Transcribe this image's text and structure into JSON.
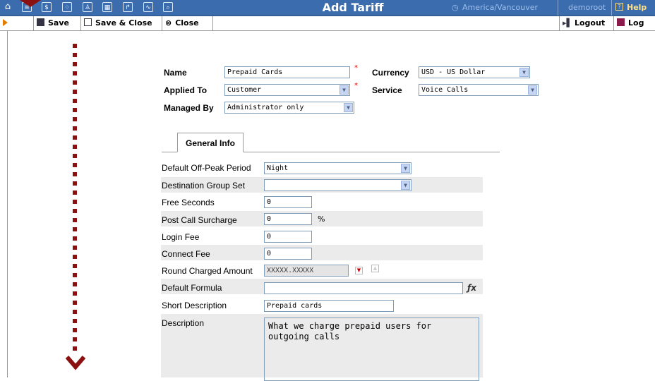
{
  "header": {
    "title": "Add Tariff",
    "timezone": "America/Vancouver",
    "user": "demoroot",
    "help": "Help",
    "nav_icons": [
      "home-icon",
      "list-icon",
      "dollar-icon",
      "network-icon",
      "person-icon",
      "grid-icon",
      "import-icon",
      "chart-icon",
      "search-icon"
    ]
  },
  "toolbar": {
    "save": "Save",
    "save_close": "Save & Close",
    "close": "Close",
    "logout": "Logout",
    "log": "Log"
  },
  "form": {
    "name_label": "Name",
    "name_value": "Prepaid Cards",
    "applied_to_label": "Applied To",
    "applied_to_value": "Customer",
    "managed_by_label": "Managed By",
    "managed_by_value": "Administrator only",
    "currency_label": "Currency",
    "currency_value": "USD - US Dollar",
    "service_label": "Service",
    "service_value": "Voice Calls",
    "required_mark": "*"
  },
  "tabs": {
    "general": "General Info"
  },
  "general": {
    "offpeak_label": "Default Off-Peak Period",
    "offpeak_value": "Night",
    "destgroup_label": "Destination Group Set",
    "destgroup_value": "",
    "freesec_label": "Free Seconds",
    "freesec_value": "0",
    "surcharge_label": "Post Call Surcharge",
    "surcharge_value": "0",
    "surcharge_unit": "%",
    "loginfee_label": "Login Fee",
    "loginfee_value": "0",
    "connectfee_label": "Connect Fee",
    "connectfee_value": "0",
    "round_label": "Round Charged Amount",
    "round_value": "XXXXX.XXXXX",
    "formula_label": "Default Formula",
    "formula_value": "",
    "shortdesc_label": "Short Description",
    "shortdesc_value": "Prepaid cards",
    "desc_label": "Description",
    "desc_value": "What we charge prepaid users for\noutgoing calls"
  },
  "colors": {
    "header": "#3b6cae",
    "annotation": "#8b1010",
    "accent": "#e07d00"
  }
}
